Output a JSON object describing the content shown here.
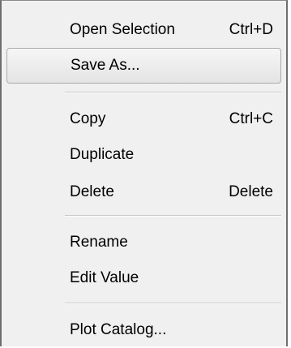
{
  "menu": {
    "items": [
      {
        "label": "Open Selection",
        "shortcut": "Ctrl+D"
      },
      {
        "label": "Save As...",
        "shortcut": ""
      },
      {
        "label": "Copy",
        "shortcut": "Ctrl+C"
      },
      {
        "label": "Duplicate",
        "shortcut": ""
      },
      {
        "label": "Delete",
        "shortcut": "Delete"
      },
      {
        "label": "Rename",
        "shortcut": ""
      },
      {
        "label": "Edit Value",
        "shortcut": ""
      },
      {
        "label": "Plot Catalog...",
        "shortcut": ""
      }
    ],
    "highlighted_item": "Save As..."
  }
}
